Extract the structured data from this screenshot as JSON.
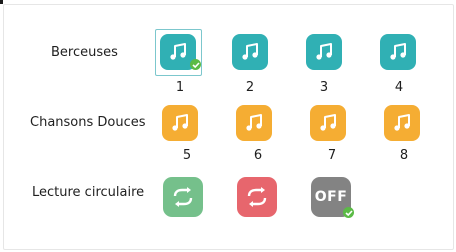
{
  "rows": {
    "berceuses": {
      "label": "Berceuses",
      "items": [
        {
          "number": "1",
          "icon": "music-note-icon",
          "selected": true
        },
        {
          "number": "2",
          "icon": "music-note-icon"
        },
        {
          "number": "3",
          "icon": "music-note-icon"
        },
        {
          "number": "4",
          "icon": "music-note-icon"
        }
      ]
    },
    "chansons_douces": {
      "label": "Chansons Douces",
      "items": [
        {
          "number": "5",
          "icon": "music-note-icon"
        },
        {
          "number": "6",
          "icon": "music-note-icon"
        },
        {
          "number": "7",
          "icon": "music-note-icon"
        },
        {
          "number": "8",
          "icon": "music-note-icon"
        }
      ]
    },
    "lecture_circulaire": {
      "label": "Lecture circulaire",
      "options": [
        {
          "icon": "loop-icon"
        },
        {
          "icon": "loop-icon"
        },
        {
          "label": "OFF",
          "selected": true
        }
      ]
    }
  },
  "colors": {
    "teal": "#30b0b4",
    "orange": "#f5ad33",
    "green": "#75c08b",
    "red": "#e7666d",
    "gray": "#838383",
    "check": "#5bbb46"
  }
}
